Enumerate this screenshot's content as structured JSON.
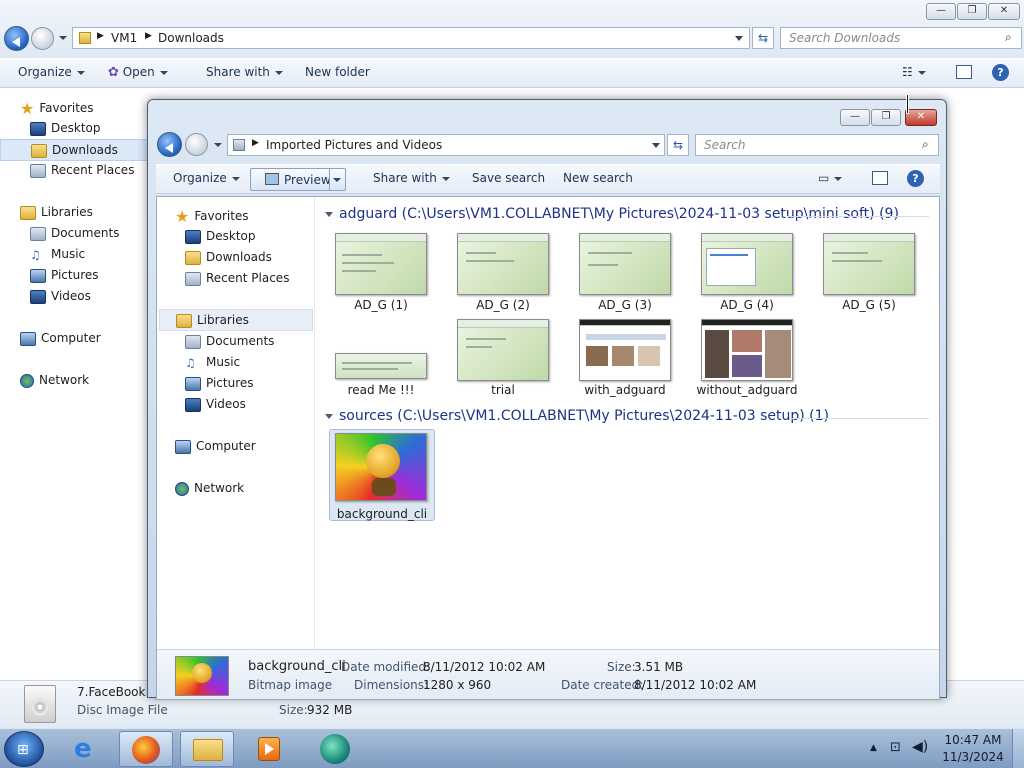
{
  "back_window": {
    "breadcrumb": [
      "VM1",
      "Downloads"
    ],
    "search_placeholder": "Search Downloads",
    "toolbar": {
      "organize": "Organize",
      "open": "Open",
      "share_with": "Share with",
      "new_folder": "New folder"
    },
    "nav": {
      "favorites": "Favorites",
      "desktop": "Desktop",
      "downloads": "Downloads",
      "recent_places": "Recent Places",
      "libraries": "Libraries",
      "documents": "Documents",
      "music": "Music",
      "pictures": "Pictures",
      "videos": "Videos",
      "computer": "Computer",
      "network": "Network"
    },
    "status": {
      "file_name": "7.FaceBook...",
      "file_type": "Disc Image File",
      "size_label": "Size:",
      "size_value": "932 MB"
    }
  },
  "front_window": {
    "breadcrumb": "Imported Pictures and Videos",
    "search_placeholder": "Search",
    "toolbar": {
      "organize": "Organize",
      "preview": "Preview",
      "share_with": "Share with",
      "save_search": "Save search",
      "new_search": "New search"
    },
    "nav": {
      "favorites": "Favorites",
      "desktop": "Desktop",
      "downloads": "Downloads",
      "recent_places": "Recent Places",
      "libraries": "Libraries",
      "documents": "Documents",
      "music": "Music",
      "pictures": "Pictures",
      "videos": "Videos",
      "computer": "Computer",
      "network": "Network"
    },
    "groups": [
      {
        "header": "adguard (C:\\Users\\VM1.COLLABNET\\My Pictures\\2024-11-03 setup\\mini soft) (9)",
        "items": [
          "AD_G (1)",
          "AD_G (2)",
          "AD_G (3)",
          "AD_G (4)",
          "AD_G (5)",
          "read Me !!!",
          "trial",
          "with_adguard",
          "without_adguard"
        ]
      },
      {
        "header": "sources (C:\\Users\\VM1.COLLABNET\\My Pictures\\2024-11-03 setup) (1)",
        "items": [
          "background_cli"
        ]
      }
    ],
    "details": {
      "name": "background_cli",
      "type": "Bitmap image",
      "date_modified_label": "Date modified:",
      "date_modified": "8/11/2012 10:02 AM",
      "dimensions_label": "Dimensions:",
      "dimensions": "1280 x 960",
      "size_label": "Size:",
      "size": "3.51 MB",
      "date_created_label": "Date created:",
      "date_created": "8/11/2012 10:02 AM"
    }
  },
  "taskbar": {
    "time": "10:47 AM",
    "date": "11/3/2024"
  }
}
